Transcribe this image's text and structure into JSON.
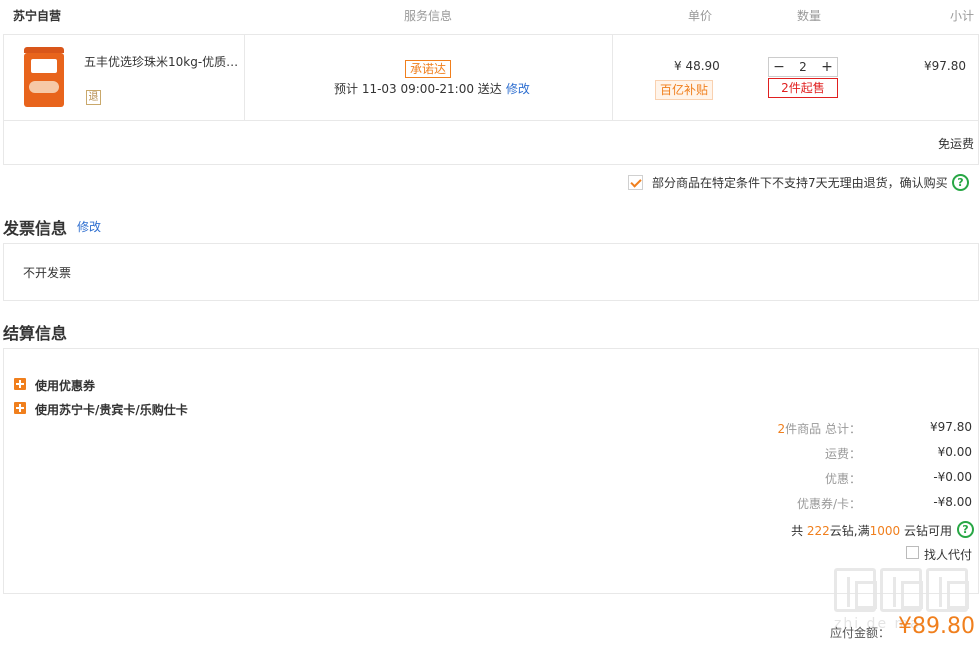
{
  "header": {
    "store": "苏宁自营",
    "col_service": "服务信息",
    "col_price": "单价",
    "col_qty": "数量",
    "col_subtotal": "小计"
  },
  "product": {
    "name": "五丰优选珍珠米10kg-优质…",
    "return_badge": "退",
    "promise_tag": "承诺达",
    "delivery_text": "预计 11-03 09:00-21:00  送达",
    "delivery_edit": "修改",
    "price": "¥ 48.90",
    "subsidy_tag": "百亿补贴",
    "qty_minus": "−",
    "qty": "2",
    "qty_plus": "+",
    "min_buy": "2件起售",
    "subtotal": "¥97.80",
    "free_shipping": "免运费"
  },
  "agreement": {
    "checked": true,
    "text": "部分商品在特定条件下不支持7天无理由退货，确认购买",
    "help": "?"
  },
  "invoice": {
    "title": "发票信息",
    "edit": "修改",
    "value": "不开发票"
  },
  "settlement": {
    "title": "结算信息",
    "options": [
      {
        "label": "使用优惠券"
      },
      {
        "label": "使用苏宁卡/贵宾卡/乐购仕卡"
      }
    ],
    "summary": {
      "items_count": "2",
      "items_label": "件商品 总计：",
      "items_total": "¥97.80",
      "shipping_label": "运费：",
      "shipping": "¥0.00",
      "discount_label": "优惠：",
      "discount": "-¥0.00",
      "coupon_label": "优惠券/卡：",
      "coupon": "-¥8.00"
    },
    "coins": {
      "prefix": "共 ",
      "count": "222",
      "middle": "云钻,满",
      "threshold": "1000",
      "suffix": " 云钻可用",
      "help": "?"
    },
    "proxy_pay": "找人代付"
  },
  "total": {
    "label": "应付金额：",
    "value": "¥89.80"
  },
  "watermark": "zhi de mai"
}
